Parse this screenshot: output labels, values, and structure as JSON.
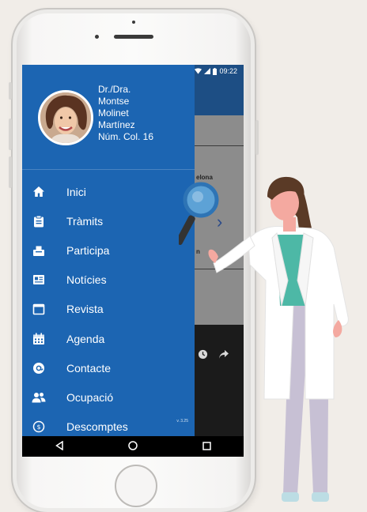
{
  "status_bar": {
    "time": "09:22"
  },
  "profile": {
    "lines": [
      "Dr./Dra.",
      "Montse",
      "Molinet",
      "Martínez",
      "Núm. Col. 16"
    ]
  },
  "menu": {
    "items": [
      {
        "label": "Inici",
        "icon": "home-icon"
      },
      {
        "label": "Tràmits",
        "icon": "clipboard-icon"
      },
      {
        "label": "Participa",
        "icon": "ballot-box-icon"
      },
      {
        "label": "Notícies",
        "icon": "newspaper-icon"
      },
      {
        "label": "Revista",
        "icon": "magazine-icon"
      },
      {
        "label": "Agenda",
        "icon": "calendar-icon"
      },
      {
        "label": "Contacte",
        "icon": "at-sign-icon"
      },
      {
        "label": "Ocupació",
        "icon": "people-icon"
      },
      {
        "label": "Descomptes",
        "icon": "discount-icon"
      }
    ]
  },
  "version": "v. 3.25",
  "background_app": {
    "text1": "elona",
    "text2": "n"
  },
  "colors": {
    "drawer": "#1c65b2",
    "header": "#1d4e84",
    "page_bg": "#f1ede8"
  }
}
